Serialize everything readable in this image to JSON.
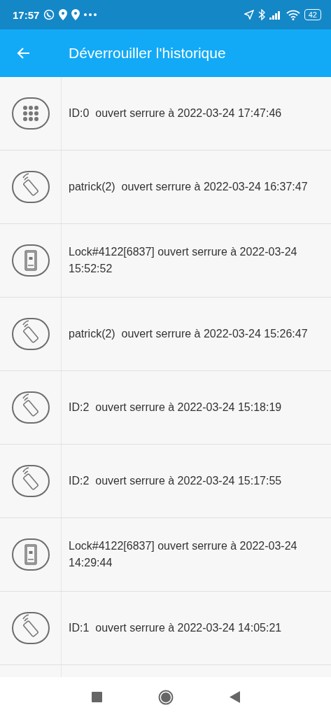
{
  "status_bar": {
    "time": "17:57",
    "battery": "42"
  },
  "app_bar": {
    "title": "Déverrouiller l'historique"
  },
  "entries": [
    {
      "kind": "keypad",
      "text": "ID:0  ouvert serrure à 2022-03-24 17:47:46"
    },
    {
      "kind": "card",
      "text": "patrick(2)  ouvert serrure à 2022-03-24 16:37:47"
    },
    {
      "kind": "app",
      "text": "Lock#4122[6837] ouvert serrure à 2022-03-24 15:52:52"
    },
    {
      "kind": "card",
      "text": "patrick(2)  ouvert serrure à 2022-03-24 15:26:47"
    },
    {
      "kind": "card",
      "text": "ID:2  ouvert serrure à 2022-03-24 15:18:19"
    },
    {
      "kind": "card",
      "text": "ID:2  ouvert serrure à 2022-03-24 15:17:55"
    },
    {
      "kind": "app",
      "text": "Lock#4122[6837] ouvert serrure à 2022-03-24 14:29:44"
    },
    {
      "kind": "card",
      "text": "ID:1  ouvert serrure à 2022-03-24 14:05:21"
    }
  ]
}
